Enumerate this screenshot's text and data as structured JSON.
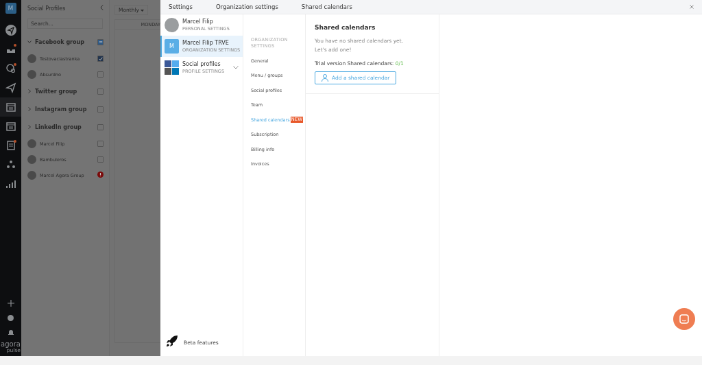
{
  "rail": {
    "avatar": "M",
    "logo": "agora",
    "logo_sub": "pulse",
    "badges": [
      false,
      true,
      true,
      false,
      false,
      false,
      true,
      false,
      false
    ]
  },
  "sidebar": {
    "title": "Social Profiles",
    "search": {
      "placeholder": "Search..."
    },
    "rows": [
      {
        "kind": "group",
        "label": "Facebook group",
        "expanded": true,
        "indeterminate": true
      },
      {
        "kind": "profile",
        "label": "Testovaciastranka",
        "checked": true
      },
      {
        "kind": "profile",
        "label": "Absurdno",
        "checked": false
      },
      {
        "kind": "group",
        "label": "Twitter group",
        "expanded": false,
        "checked": false
      },
      {
        "kind": "group",
        "label": "Instagram group",
        "expanded": false,
        "checked": false
      },
      {
        "kind": "group",
        "label": "LinkedIn group",
        "expanded": false,
        "checked": false
      },
      {
        "kind": "profile",
        "label": "Marcel Filip",
        "checked": false
      },
      {
        "kind": "profile",
        "label": "Bambuleros",
        "checked": false
      },
      {
        "kind": "profile",
        "label": "Marcel Agora Group",
        "error": true
      }
    ]
  },
  "calendar": {
    "view": "Monthly",
    "day": "MONDAY"
  },
  "settings": {
    "breadcrumb": [
      "Settings",
      "Organization settings",
      "Shared calendars"
    ],
    "accounts": [
      {
        "kind": "photo",
        "name": "Marcel Filip",
        "subtitle": "PERSONAL SETTINGS",
        "selected": false,
        "expandable": false
      },
      {
        "kind": "letter",
        "initial": "M",
        "name": "Marcel Filip TRVE",
        "subtitle": "ORGANIZATION SETTINGS",
        "selected": true,
        "expandable": false
      },
      {
        "kind": "mosaic",
        "name": "Social profiles",
        "subtitle": "PROFILE SETTINGS",
        "selected": false,
        "expandable": true
      }
    ],
    "beta": "Beta features",
    "nav_heading": "ORGANIZATION SETTINGS",
    "nav": [
      {
        "label": "General",
        "selected": false
      },
      {
        "label": "Menu / groups",
        "selected": false
      },
      {
        "label": "Social profiles",
        "selected": false
      },
      {
        "label": "Team",
        "selected": false
      },
      {
        "label": "Shared calendars",
        "selected": true,
        "badge": "NEW"
      },
      {
        "label": "Subscription",
        "selected": false
      },
      {
        "label": "Billing info",
        "selected": false
      },
      {
        "label": "Invoices",
        "selected": false
      }
    ],
    "content": {
      "title": "Shared calendars",
      "empty_lines": [
        "You have no shared calendars yet.",
        "Let's add one!"
      ],
      "trial_label": "Trial version Shared calendars:",
      "trial_count": "0/1",
      "button": "Add a shared calendar"
    }
  }
}
